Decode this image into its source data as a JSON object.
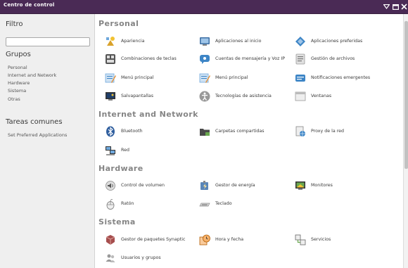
{
  "window": {
    "title": "Centro de control"
  },
  "sidebar": {
    "filter_heading": "Filtro",
    "filter_value": "",
    "groups_heading": "Grupos",
    "groups": [
      "Personal",
      "Internet and Network",
      "Hardware",
      "Sistema",
      "Otras"
    ],
    "tasks_heading": "Tareas comunes",
    "tasks": [
      "Set Preferred Applications"
    ]
  },
  "sections": {
    "personal": {
      "title": "Personal",
      "apps": [
        {
          "label": "Apariencia",
          "icon": "appearance-icon"
        },
        {
          "label": "Aplicaciones al inicio",
          "icon": "startup-apps-icon"
        },
        {
          "label": "Aplicaciones preferidas",
          "icon": "preferred-apps-icon"
        },
        {
          "label": "Combinaciones de teclas",
          "icon": "keyboard-shortcuts-icon"
        },
        {
          "label": "Cuentas de mensajería y Voz IP",
          "icon": "messaging-icon"
        },
        {
          "label": "Gestión de archivos",
          "icon": "file-management-icon"
        },
        {
          "label": "Menú principal",
          "icon": "main-menu-icon"
        },
        {
          "label": "Menú principal",
          "icon": "main-menu-icon"
        },
        {
          "label": "Notificaciones emergentes",
          "icon": "notifications-icon"
        },
        {
          "label": "Salvapantallas",
          "icon": "screensaver-icon"
        },
        {
          "label": "Tecnologías de asistencia",
          "icon": "accessibility-icon"
        },
        {
          "label": "Ventanas",
          "icon": "windows-icon"
        }
      ]
    },
    "internet": {
      "title": "Internet and Network",
      "apps": [
        {
          "label": "Bluetooth",
          "icon": "bluetooth-icon"
        },
        {
          "label": "Carpetas compartidas",
          "icon": "shared-folders-icon"
        },
        {
          "label": "Proxy de la red",
          "icon": "network-proxy-icon"
        },
        {
          "label": "Red",
          "icon": "network-icon"
        }
      ]
    },
    "hardware": {
      "title": "Hardware",
      "apps": [
        {
          "label": "Control de volumen",
          "icon": "volume-icon"
        },
        {
          "label": "Gestor de energía",
          "icon": "power-icon"
        },
        {
          "label": "Monitores",
          "icon": "monitors-icon"
        },
        {
          "label": "Ratón",
          "icon": "mouse-icon"
        },
        {
          "label": "Teclado",
          "icon": "keyboard-icon"
        }
      ]
    },
    "system": {
      "title": "Sistema",
      "apps": [
        {
          "label": "Gestor de paquetes Synaptic",
          "icon": "synaptic-icon"
        },
        {
          "label": "Hora y fecha",
          "icon": "time-date-icon"
        },
        {
          "label": "Servicios",
          "icon": "services-icon"
        },
        {
          "label": "Usuarios y grupos",
          "icon": "users-groups-icon"
        }
      ]
    }
  },
  "colors": {
    "titlebar": "#4a2a55",
    "sidebar": "#efefef",
    "section_title": "#858585"
  }
}
